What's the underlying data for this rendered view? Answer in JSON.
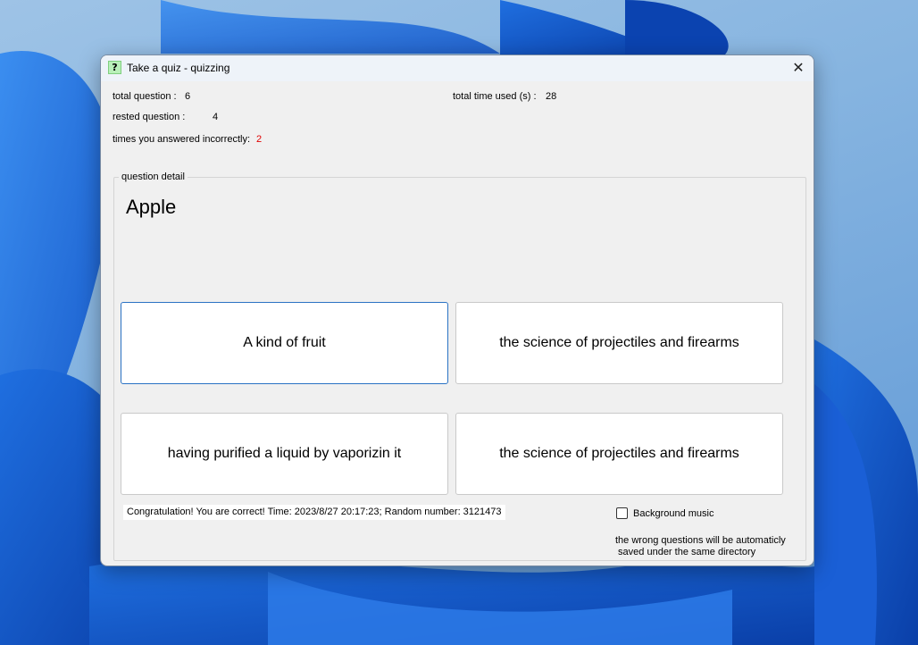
{
  "window": {
    "title": "Take a quiz - quizzing",
    "icon_glyph": "?",
    "close_glyph": "✕"
  },
  "stats": {
    "total_question_label": "total question :",
    "total_question_value": "6",
    "rested_question_label": "rested question :",
    "rested_question_value": "4",
    "incorrect_label": "times you answered incorrectly:",
    "incorrect_value": "2",
    "time_label": "total time used (s) :",
    "time_value": "28"
  },
  "question": {
    "group_label": "question detail",
    "word": "Apple"
  },
  "answers": [
    "A kind of fruit",
    "the science of projectiles and firearms",
    "having purified a liquid by vaporizin it",
    "the science of projectiles and firearms"
  ],
  "feedback": "Congratulation! You are correct! Time: 2023/8/27 20:17:23; Random number: 3121473",
  "options": {
    "background_music_label": "Background music",
    "background_music_checked": false
  },
  "note": {
    "line1": "the wrong questions will be automaticly",
    "line2": " saved under the same directory"
  },
  "colors": {
    "incorrect_count": "#e00000",
    "focused_border": "#2a72c4",
    "icon_bg": "#b9f0b9"
  }
}
